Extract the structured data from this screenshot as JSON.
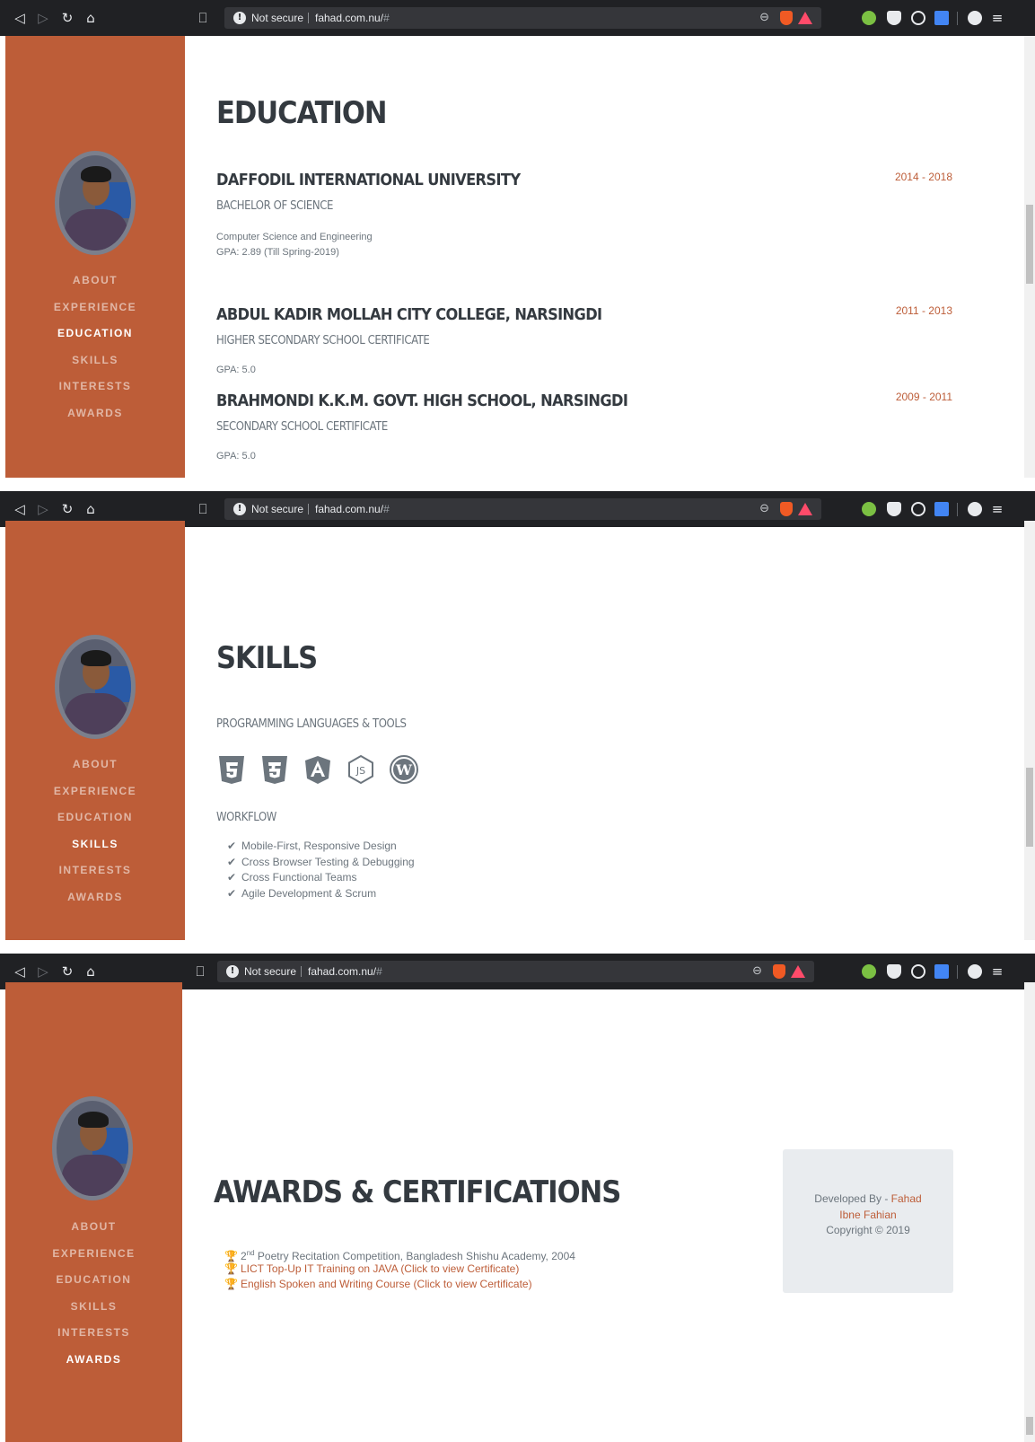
{
  "browser": {
    "security_label": "Not secure",
    "url_host": "fahad.com.nu/",
    "url_hash": "#",
    "back_icon": "back-icon",
    "forward_icon": "forward-icon",
    "reload_icon": "reload-icon",
    "home_icon": "home-icon",
    "bookmark_icon": "bookmark-icon"
  },
  "sidebar": {
    "bg_color": "#bd5d38",
    "items": [
      {
        "id": "about",
        "label": "About"
      },
      {
        "id": "experience",
        "label": "Experience"
      },
      {
        "id": "education",
        "label": "Education"
      },
      {
        "id": "skills",
        "label": "Skills"
      },
      {
        "id": "interests",
        "label": "Interests"
      },
      {
        "id": "awards",
        "label": "Awards"
      }
    ]
  },
  "education": {
    "heading": "EDUCATION",
    "entries": [
      {
        "school": "DAFFODIL INTERNATIONAL UNIVERSITY",
        "degree": "BACHELOR OF SCIENCE",
        "lines": [
          "Computer Science and Engineering",
          "GPA: 2.89 (Till Spring-2019)"
        ],
        "date": "2014 - 2018"
      },
      {
        "school": "ABDUL KADIR MOLLAH CITY COLLEGE, NARSINGDI",
        "degree": "HIGHER SECONDARY SCHOOL CERTIFICATE",
        "lines": [
          "GPA: 5.0"
        ],
        "date": "2011 - 2013"
      },
      {
        "school": "BRAHMONDI K.K.M. GOVT. HIGH SCHOOL, NARSINGDI",
        "degree": "SECONDARY SCHOOL CERTIFICATE",
        "lines": [
          "GPA: 5.0"
        ],
        "date": "2009 - 2011"
      }
    ]
  },
  "skills": {
    "heading": "SKILLS",
    "tools_heading": "PROGRAMMING LANGUAGES & TOOLS",
    "icons": [
      "html5-icon",
      "css3-icon",
      "angular-icon",
      "nodejs-icon",
      "wordpress-icon"
    ],
    "workflow_heading": "WORKFLOW",
    "workflow": [
      "Mobile-First, Responsive Design",
      "Cross Browser Testing & Debugging",
      "Cross Functional Teams",
      "Agile Development & Scrum"
    ]
  },
  "awards": {
    "heading": "AWARDS & CERTIFICATIONS",
    "items": [
      {
        "prefix": "2",
        "sup": "nd",
        "text": " Poetry Recitation Competition, Bangladesh Shishu Academy, 2004"
      },
      {
        "link": "LICT Top-Up IT Training on JAVA (Click to view Certificate)"
      },
      {
        "link": "English Spoken and Writing Course (Click to view Certificate)"
      }
    ]
  },
  "footer": {
    "developed_by": "Developed By - ",
    "name_line1": "Fahad",
    "name_line2": "Ibne Fahian",
    "copyright": "Copyright © 2019"
  },
  "colors": {
    "accent": "#bd5d38",
    "heading": "#343a40",
    "muted": "#6c757d",
    "trophy": "#ffc107"
  }
}
